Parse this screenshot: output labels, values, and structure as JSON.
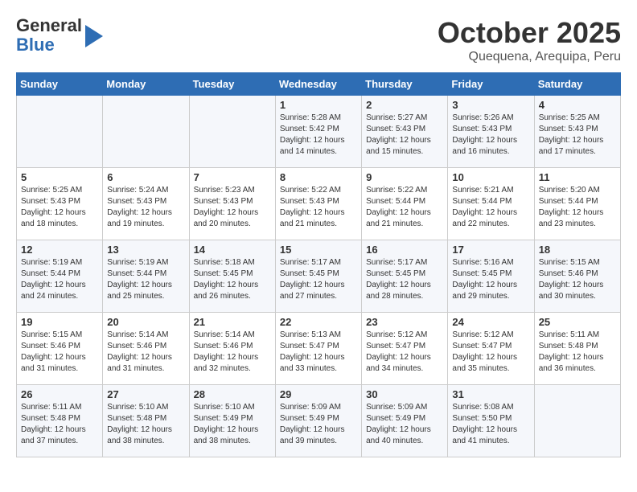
{
  "logo": {
    "line1": "General",
    "line2": "Blue"
  },
  "title": "October 2025",
  "location": "Quequena, Arequipa, Peru",
  "weekdays": [
    "Sunday",
    "Monday",
    "Tuesday",
    "Wednesday",
    "Thursday",
    "Friday",
    "Saturday"
  ],
  "weeks": [
    [
      {
        "day": "",
        "info": ""
      },
      {
        "day": "",
        "info": ""
      },
      {
        "day": "",
        "info": ""
      },
      {
        "day": "1",
        "info": "Sunrise: 5:28 AM\nSunset: 5:42 PM\nDaylight: 12 hours\nand 14 minutes."
      },
      {
        "day": "2",
        "info": "Sunrise: 5:27 AM\nSunset: 5:43 PM\nDaylight: 12 hours\nand 15 minutes."
      },
      {
        "day": "3",
        "info": "Sunrise: 5:26 AM\nSunset: 5:43 PM\nDaylight: 12 hours\nand 16 minutes."
      },
      {
        "day": "4",
        "info": "Sunrise: 5:25 AM\nSunset: 5:43 PM\nDaylight: 12 hours\nand 17 minutes."
      }
    ],
    [
      {
        "day": "5",
        "info": "Sunrise: 5:25 AM\nSunset: 5:43 PM\nDaylight: 12 hours\nand 18 minutes."
      },
      {
        "day": "6",
        "info": "Sunrise: 5:24 AM\nSunset: 5:43 PM\nDaylight: 12 hours\nand 19 minutes."
      },
      {
        "day": "7",
        "info": "Sunrise: 5:23 AM\nSunset: 5:43 PM\nDaylight: 12 hours\nand 20 minutes."
      },
      {
        "day": "8",
        "info": "Sunrise: 5:22 AM\nSunset: 5:43 PM\nDaylight: 12 hours\nand 21 minutes."
      },
      {
        "day": "9",
        "info": "Sunrise: 5:22 AM\nSunset: 5:44 PM\nDaylight: 12 hours\nand 21 minutes."
      },
      {
        "day": "10",
        "info": "Sunrise: 5:21 AM\nSunset: 5:44 PM\nDaylight: 12 hours\nand 22 minutes."
      },
      {
        "day": "11",
        "info": "Sunrise: 5:20 AM\nSunset: 5:44 PM\nDaylight: 12 hours\nand 23 minutes."
      }
    ],
    [
      {
        "day": "12",
        "info": "Sunrise: 5:19 AM\nSunset: 5:44 PM\nDaylight: 12 hours\nand 24 minutes."
      },
      {
        "day": "13",
        "info": "Sunrise: 5:19 AM\nSunset: 5:44 PM\nDaylight: 12 hours\nand 25 minutes."
      },
      {
        "day": "14",
        "info": "Sunrise: 5:18 AM\nSunset: 5:45 PM\nDaylight: 12 hours\nand 26 minutes."
      },
      {
        "day": "15",
        "info": "Sunrise: 5:17 AM\nSunset: 5:45 PM\nDaylight: 12 hours\nand 27 minutes."
      },
      {
        "day": "16",
        "info": "Sunrise: 5:17 AM\nSunset: 5:45 PM\nDaylight: 12 hours\nand 28 minutes."
      },
      {
        "day": "17",
        "info": "Sunrise: 5:16 AM\nSunset: 5:45 PM\nDaylight: 12 hours\nand 29 minutes."
      },
      {
        "day": "18",
        "info": "Sunrise: 5:15 AM\nSunset: 5:46 PM\nDaylight: 12 hours\nand 30 minutes."
      }
    ],
    [
      {
        "day": "19",
        "info": "Sunrise: 5:15 AM\nSunset: 5:46 PM\nDaylight: 12 hours\nand 31 minutes."
      },
      {
        "day": "20",
        "info": "Sunrise: 5:14 AM\nSunset: 5:46 PM\nDaylight: 12 hours\nand 31 minutes."
      },
      {
        "day": "21",
        "info": "Sunrise: 5:14 AM\nSunset: 5:46 PM\nDaylight: 12 hours\nand 32 minutes."
      },
      {
        "day": "22",
        "info": "Sunrise: 5:13 AM\nSunset: 5:47 PM\nDaylight: 12 hours\nand 33 minutes."
      },
      {
        "day": "23",
        "info": "Sunrise: 5:12 AM\nSunset: 5:47 PM\nDaylight: 12 hours\nand 34 minutes."
      },
      {
        "day": "24",
        "info": "Sunrise: 5:12 AM\nSunset: 5:47 PM\nDaylight: 12 hours\nand 35 minutes."
      },
      {
        "day": "25",
        "info": "Sunrise: 5:11 AM\nSunset: 5:48 PM\nDaylight: 12 hours\nand 36 minutes."
      }
    ],
    [
      {
        "day": "26",
        "info": "Sunrise: 5:11 AM\nSunset: 5:48 PM\nDaylight: 12 hours\nand 37 minutes."
      },
      {
        "day": "27",
        "info": "Sunrise: 5:10 AM\nSunset: 5:48 PM\nDaylight: 12 hours\nand 38 minutes."
      },
      {
        "day": "28",
        "info": "Sunrise: 5:10 AM\nSunset: 5:49 PM\nDaylight: 12 hours\nand 38 minutes."
      },
      {
        "day": "29",
        "info": "Sunrise: 5:09 AM\nSunset: 5:49 PM\nDaylight: 12 hours\nand 39 minutes."
      },
      {
        "day": "30",
        "info": "Sunrise: 5:09 AM\nSunset: 5:49 PM\nDaylight: 12 hours\nand 40 minutes."
      },
      {
        "day": "31",
        "info": "Sunrise: 5:08 AM\nSunset: 5:50 PM\nDaylight: 12 hours\nand 41 minutes."
      },
      {
        "day": "",
        "info": ""
      }
    ]
  ]
}
